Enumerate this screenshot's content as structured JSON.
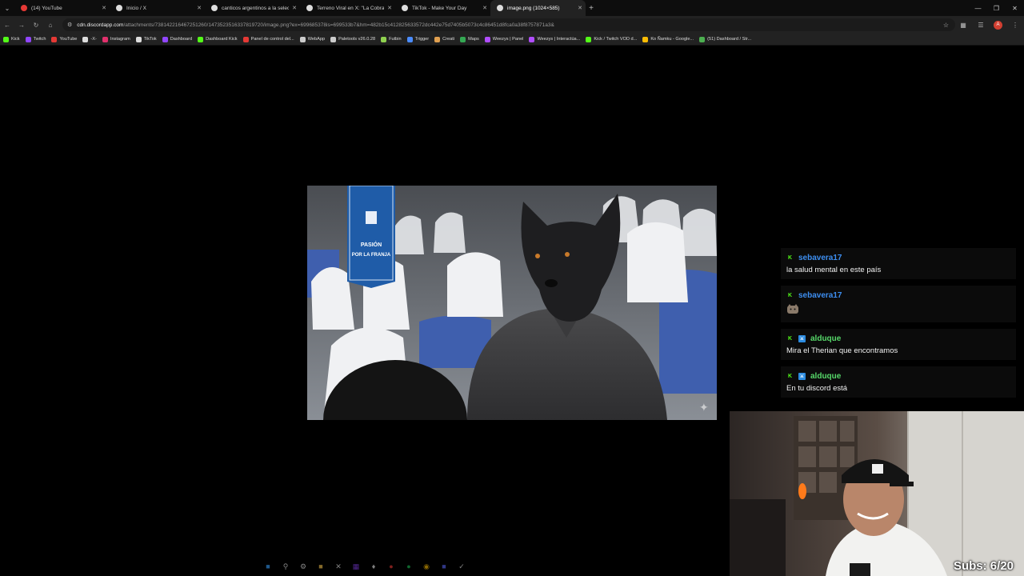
{
  "browser": {
    "tabs": [
      {
        "title": "(14) YouTube",
        "icon": "youtube-icon",
        "color": "#e53935",
        "active": false
      },
      {
        "title": "Inicio / X",
        "icon": "x-icon",
        "color": "#dddddd",
        "active": false
      },
      {
        "title": "canticos argentinos a la selecci",
        "icon": "google-icon",
        "color": "#dddddd",
        "active": false
      },
      {
        "title": "Terreno Viral en X: \"La Cobra s",
        "icon": "x-icon",
        "color": "#dddddd",
        "active": false
      },
      {
        "title": "TikTok - Make Your Day",
        "icon": "tiktok-icon",
        "color": "#dddddd",
        "active": false
      },
      {
        "title": "image.png (1024×585)",
        "icon": "globe-icon",
        "color": "#dddddd",
        "active": true
      }
    ],
    "url_host": "cdn.discordapp.com",
    "url_path": "/attachments/738142216467251260/1473523516337819720/image.png?ex=699685378is=699533b7&hm=482b15c412825633572dc442e75d7405b5073c4c86451d8fca0a38f8757871a3&",
    "profile_initial": "A",
    "bookmarks": [
      {
        "label": "Kick",
        "icon": "kick-icon",
        "color": "#53fc18"
      },
      {
        "label": "Twitch",
        "icon": "twitch-icon",
        "color": "#9146ff"
      },
      {
        "label": "YouTube",
        "icon": "youtube-icon",
        "color": "#e53935"
      },
      {
        "label": "-X-",
        "icon": "x-icon",
        "color": "#dddddd"
      },
      {
        "label": "Instagram",
        "icon": "instagram-icon",
        "color": "#e1306c"
      },
      {
        "label": "TikTok",
        "icon": "tiktok-icon",
        "color": "#dddddd"
      },
      {
        "label": "Dashboard",
        "icon": "twitch-icon",
        "color": "#9146ff"
      },
      {
        "label": "Dashboard Kick",
        "icon": "kick-icon",
        "color": "#53fc18"
      },
      {
        "label": "Panel de control del...",
        "icon": "youtube-icon",
        "color": "#e53935"
      },
      {
        "label": "WebApp",
        "icon": "app-icon",
        "color": "#cccccc"
      },
      {
        "label": "Paletools v26.0.28",
        "icon": "palette-icon",
        "color": "#cccccc"
      },
      {
        "label": "Futbin",
        "icon": "futbin-icon",
        "color": "#8fd14f"
      },
      {
        "label": "Trigger",
        "icon": "trigger-icon",
        "color": "#4a8cff"
      },
      {
        "label": "Creati",
        "icon": "creati-icon",
        "color": "#e0a050"
      },
      {
        "label": "Maps",
        "icon": "map-pin-icon",
        "color": "#34a853"
      },
      {
        "label": "Weezys | Panel",
        "icon": "weezys-icon",
        "color": "#b04dff"
      },
      {
        "label": "Weezys | Interactúa...",
        "icon": "weezys-icon",
        "color": "#b04dff"
      },
      {
        "label": "Kick / Twitch VOD d...",
        "icon": "kick-icon",
        "color": "#53fc18"
      },
      {
        "label": "Ko Ñamku - Google...",
        "icon": "drive-icon",
        "color": "#fbbc04"
      },
      {
        "label": "(51) Dashboard / Str...",
        "icon": "dashboard-icon",
        "color": "#4caf50"
      }
    ]
  },
  "chat": {
    "messages": [
      {
        "user": "sebavera17",
        "user_color": "#3d8ef0",
        "mod": false,
        "text": "la salud mental en este país"
      },
      {
        "user": "sebavera17",
        "user_color": "#3d8ef0",
        "mod": false,
        "text": "",
        "emote": "cat-emote"
      },
      {
        "user": "alduque",
        "user_color": "#57d96a",
        "mod": true,
        "text": "Mira el Therian que encontramos"
      },
      {
        "user": "alduque",
        "user_color": "#57d96a",
        "mod": true,
        "text": "En tu discord está"
      }
    ]
  },
  "scene": {
    "banner_line1": "PASIÓN",
    "banner_line2": "POR LA FRANJA"
  },
  "overlay": {
    "subs": "Subs: 6/20"
  }
}
